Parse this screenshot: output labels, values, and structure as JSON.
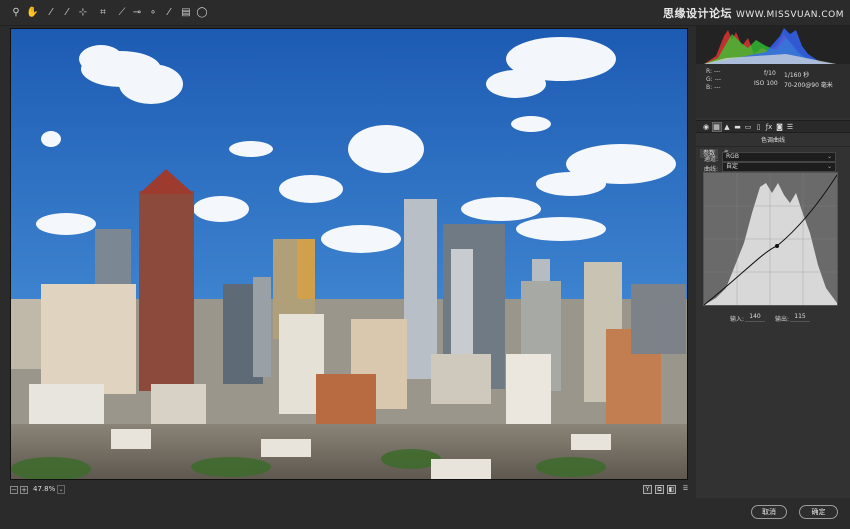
{
  "toolbar": {
    "tools": [
      {
        "name": "zoom-tool-icon",
        "glyph": "⚲"
      },
      {
        "name": "hand-tool-icon",
        "glyph": "✋"
      },
      {
        "name": "white-balance-tool-icon",
        "glyph": "⁄"
      },
      {
        "name": "color-sampler-tool-icon",
        "glyph": "⁄"
      },
      {
        "name": "targeted-adjustment-tool-icon",
        "glyph": "⊹"
      },
      {
        "name": "crop-tool-icon",
        "glyph": "⌗"
      },
      {
        "name": "straighten-tool-icon",
        "glyph": "⟋"
      },
      {
        "name": "spot-removal-tool-icon",
        "glyph": "⊸"
      },
      {
        "name": "red-eye-tool-icon",
        "glyph": "∘"
      },
      {
        "name": "adjustment-brush-icon",
        "glyph": "⁄"
      },
      {
        "name": "graduated-filter-icon",
        "glyph": "▤"
      },
      {
        "name": "radial-filter-icon",
        "glyph": "◯"
      }
    ],
    "watermark_text": "思缘设计论坛",
    "watermark_url": "WWW.MISSVUAN.COM"
  },
  "status": {
    "zoom_minus": "−",
    "zoom_plus": "+",
    "zoom_level": "47.8%",
    "zoom_dropdown": "⌄",
    "view_buttons": [
      "Y",
      "⧉",
      "◧",
      "☰"
    ]
  },
  "panel": {
    "rgb": {
      "r_label": "R:",
      "r_value": "---",
      "g_label": "G:",
      "g_value": "---",
      "b_label": "B:",
      "b_value": "---"
    },
    "camera": {
      "aperture": "f/10",
      "shutter": "1/160 秒",
      "iso": "ISO 100",
      "lens": "70-200@90 毫米"
    },
    "tab_icons": [
      {
        "name": "basic-tab-icon",
        "glyph": "◉"
      },
      {
        "name": "tone-curve-tab-icon",
        "glyph": "▦"
      },
      {
        "name": "detail-tab-icon",
        "glyph": "▲"
      },
      {
        "name": "hsl-tab-icon",
        "glyph": "▬"
      },
      {
        "name": "split-toning-tab-icon",
        "glyph": "▭"
      },
      {
        "name": "lens-corrections-tab-icon",
        "glyph": "▯"
      },
      {
        "name": "effects-tab-icon",
        "glyph": "ƒx"
      },
      {
        "name": "camera-calibration-tab-icon",
        "glyph": "◙"
      },
      {
        "name": "presets-tab-icon",
        "glyph": "☰"
      }
    ],
    "title": "色调曲线",
    "subtabs": [
      "参数",
      "点"
    ],
    "curve_label": "曲线:",
    "curve_value": "自定",
    "channel_label": "通道:",
    "channel_value": "RGB",
    "input_label": "输入:",
    "input_value": "140",
    "output_label": "输出:",
    "output_value": "115"
  },
  "buttons": {
    "cancel": "取消",
    "ok": "确定"
  },
  "colors": {
    "background": "#2b2b2b",
    "panel": "#323232",
    "sky": "#2f6fc0"
  }
}
